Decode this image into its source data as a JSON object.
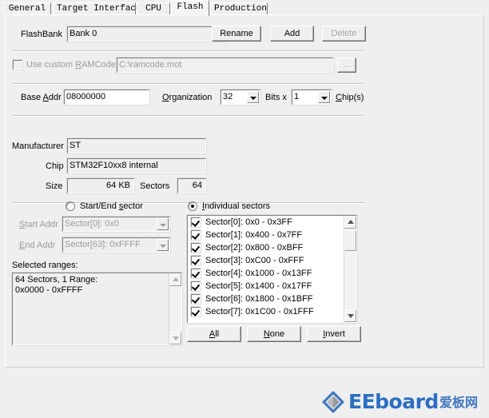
{
  "tabs": [
    {
      "label": "General",
      "active": false
    },
    {
      "label": "Target Interface",
      "active": false
    },
    {
      "label": "CPU",
      "active": false
    },
    {
      "label": "Flash",
      "active": true
    },
    {
      "label": "Production",
      "active": false
    }
  ],
  "flashbank": {
    "label": "FlashBank",
    "value": "Bank 0",
    "rename_label": "Rename",
    "add_label": "Add",
    "delete_label": "Delete"
  },
  "ramcode": {
    "checkbox_label_pre": "Use custom ",
    "checkbox_label_mnemonic": "R",
    "checkbox_label_post": "AMCode",
    "checked": false,
    "path": "C:\\ramcode.mot",
    "browse_label": "..."
  },
  "addr": {
    "base_label_pre": "Base ",
    "base_label_mnemonic": "A",
    "base_label_post": "ddr",
    "base_value": "08000000",
    "org_label_mnemonic": "O",
    "org_label_post": "rganization",
    "org_value": "32",
    "bits_label": "Bits x",
    "chips_value": "1",
    "chips_label_mnemonic": "C",
    "chips_label_post": "hip(s)"
  },
  "device": {
    "manufacturer_label": "Manufacturer",
    "manufacturer_value": "ST",
    "chip_label": "Chip",
    "chip_value": "STM32F10xx8 internal",
    "size_label": "Size",
    "size_value": "64 KB",
    "sectors_label": "Sectors",
    "sectors_value": "64"
  },
  "selection_mode": {
    "startend_mnemonic_pre": "Start/End ",
    "startend_mnemonic": "s",
    "startend_post": "ector",
    "startend_selected": false,
    "individual_pre": "I",
    "individual_mnemonic_post": "ndividual sectors",
    "individual_selected": true
  },
  "startend": {
    "start_label_mnemonic": "S",
    "start_label_post": "tart Addr",
    "start_value": "Sector[0]: 0x0",
    "end_label_mnemonic": "E",
    "end_label_post": "nd Addr",
    "end_value": "Sector[63]: 0xFFFF"
  },
  "sector_list": [
    {
      "label": "Sector[0]: 0x0 - 0x3FF",
      "checked": true
    },
    {
      "label": "Sector[1]: 0x400 - 0x7FF",
      "checked": true
    },
    {
      "label": "Sector[2]: 0x800 - 0xBFF",
      "checked": true
    },
    {
      "label": "Sector[3]: 0xC00 - 0xFFF",
      "checked": true
    },
    {
      "label": "Sector[4]: 0x1000 - 0x13FF",
      "checked": true
    },
    {
      "label": "Sector[5]: 0x1400 - 0x17FF",
      "checked": true
    },
    {
      "label": "Sector[6]: 0x1800 - 0x1BFF",
      "checked": true
    },
    {
      "label": "Sector[7]: 0x1C00 - 0x1FFF",
      "checked": true
    }
  ],
  "selected_ranges": {
    "label": "Selected ranges:",
    "text": "64 Sectors, 1 Range:\n0x0000 - 0xFFFF"
  },
  "selection_buttons": {
    "all_mnemonic": "A",
    "all_post": "ll",
    "none_mnemonic": "N",
    "none_post": "one",
    "invert_mnemonic": "I",
    "invert_post": "nvert"
  },
  "watermark": {
    "text": "EEboard",
    "text_cn": "爱板网"
  },
  "colors": {
    "dialog_bg": "#efefef",
    "field_bg": "#ffffff",
    "disabled_text": "#9a9a9a",
    "watermark_blue": "#2b6ec4"
  }
}
